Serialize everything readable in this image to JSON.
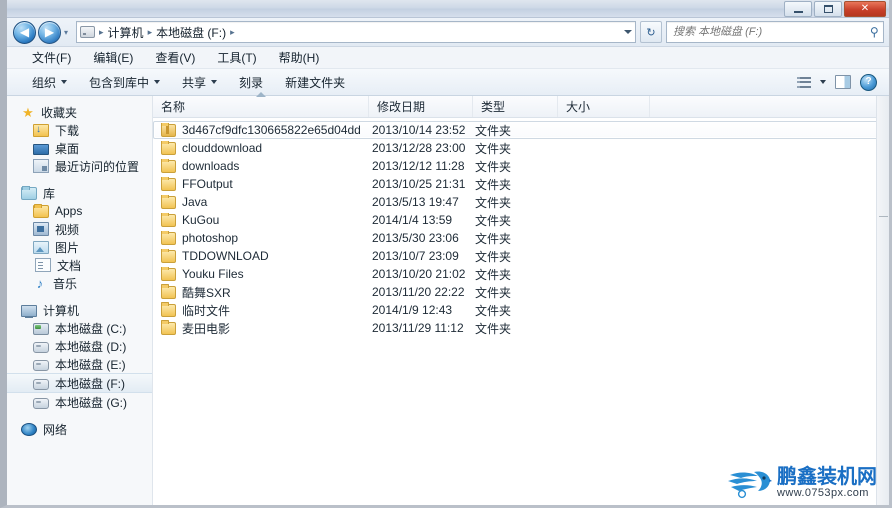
{
  "window": {
    "buttons": {
      "minimize": "—",
      "maximize": "□",
      "close": "✕"
    }
  },
  "nav": {
    "back": "◀",
    "forward": "▶",
    "history_caret": "▾",
    "refresh": "↻",
    "breadcrumb": [
      "计算机",
      "本地磁盘 (F:)"
    ],
    "separator": "▸"
  },
  "search": {
    "placeholder": "搜索 本地磁盘 (F:)",
    "value": "",
    "icon": "⚲"
  },
  "menubar": {
    "items": [
      {
        "label": "文件(F)"
      },
      {
        "label": "编辑(E)"
      },
      {
        "label": "查看(V)"
      },
      {
        "label": "工具(T)"
      },
      {
        "label": "帮助(H)"
      }
    ]
  },
  "commandbar": {
    "items": [
      {
        "label": "组织",
        "caret": true
      },
      {
        "label": "包含到库中",
        "caret": true
      },
      {
        "label": "共享",
        "caret": true
      },
      {
        "label": "刻录",
        "caret": false
      },
      {
        "label": "新建文件夹",
        "caret": false
      }
    ],
    "help_glyph": "?"
  },
  "sidebar": {
    "groups": [
      {
        "header": {
          "label": "收藏夹",
          "icon": "star-icon"
        },
        "items": [
          {
            "label": "下载",
            "icon": "downloads-icon"
          },
          {
            "label": "桌面",
            "icon": "desktop-icon"
          },
          {
            "label": "最近访问的位置",
            "icon": "recent-places-icon"
          }
        ]
      },
      {
        "header": {
          "label": "库",
          "icon": "library-icon"
        },
        "items": [
          {
            "label": "Apps",
            "icon": "folder-icon"
          },
          {
            "label": "视频",
            "icon": "video-icon"
          },
          {
            "label": "图片",
            "icon": "pictures-icon"
          },
          {
            "label": "文档",
            "icon": "documents-icon"
          },
          {
            "label": "音乐",
            "icon": "music-icon"
          }
        ]
      },
      {
        "header": {
          "label": "计算机",
          "icon": "computer-icon"
        },
        "items": [
          {
            "label": "本地磁盘 (C:)",
            "icon": "system-drive-icon",
            "selected": false
          },
          {
            "label": "本地磁盘 (D:)",
            "icon": "drive-icon",
            "selected": false
          },
          {
            "label": "本地磁盘 (E:)",
            "icon": "drive-icon",
            "selected": false
          },
          {
            "label": "本地磁盘 (F:)",
            "icon": "drive-icon",
            "selected": true
          },
          {
            "label": "本地磁盘 (G:)",
            "icon": "drive-icon",
            "selected": false
          }
        ]
      },
      {
        "header": {
          "label": "网络",
          "icon": "network-icon"
        },
        "items": []
      }
    ]
  },
  "filelist": {
    "columns": [
      {
        "key": "name",
        "label": "名称"
      },
      {
        "key": "date",
        "label": "修改日期"
      },
      {
        "key": "type",
        "label": "类型"
      },
      {
        "key": "size",
        "label": "大小"
      }
    ],
    "sort_column": "name",
    "sort_direction": "ascending",
    "rows": [
      {
        "name": "3d467cf9dfc130665822e65d04dd",
        "date": "2013/10/14 23:52",
        "type": "文件夹",
        "size": "",
        "icon": "zip-folder-icon",
        "selected": true
      },
      {
        "name": "clouddownload",
        "date": "2013/12/28 23:00",
        "type": "文件夹",
        "size": "",
        "icon": "folder-icon",
        "selected": false
      },
      {
        "name": "downloads",
        "date": "2013/12/12 11:28",
        "type": "文件夹",
        "size": "",
        "icon": "folder-icon",
        "selected": false
      },
      {
        "name": "FFOutput",
        "date": "2013/10/25 21:31",
        "type": "文件夹",
        "size": "",
        "icon": "folder-icon",
        "selected": false
      },
      {
        "name": "Java",
        "date": "2013/5/13 19:47",
        "type": "文件夹",
        "size": "",
        "icon": "folder-icon",
        "selected": false
      },
      {
        "name": "KuGou",
        "date": "2014/1/4 13:59",
        "type": "文件夹",
        "size": "",
        "icon": "folder-icon",
        "selected": false
      },
      {
        "name": "photoshop",
        "date": "2013/5/30 23:06",
        "type": "文件夹",
        "size": "",
        "icon": "folder-icon",
        "selected": false
      },
      {
        "name": "TDDOWNLOAD",
        "date": "2013/10/7 23:09",
        "type": "文件夹",
        "size": "",
        "icon": "folder-icon",
        "selected": false
      },
      {
        "name": "Youku Files",
        "date": "2013/10/20 21:02",
        "type": "文件夹",
        "size": "",
        "icon": "folder-icon",
        "selected": false
      },
      {
        "name": "酷舞SXR",
        "date": "2013/11/20 22:22",
        "type": "文件夹",
        "size": "",
        "icon": "folder-icon",
        "selected": false
      },
      {
        "name": "临时文件",
        "date": "2014/1/9 12:43",
        "type": "文件夹",
        "size": "",
        "icon": "folder-icon",
        "selected": false
      },
      {
        "name": "麦田电影",
        "date": "2013/11/29 11:12",
        "type": "文件夹",
        "size": "",
        "icon": "folder-icon",
        "selected": false
      }
    ]
  },
  "watermark": {
    "title": "鹏鑫装机网",
    "url": "www.0753px.com",
    "color": "#1a6fc4"
  }
}
